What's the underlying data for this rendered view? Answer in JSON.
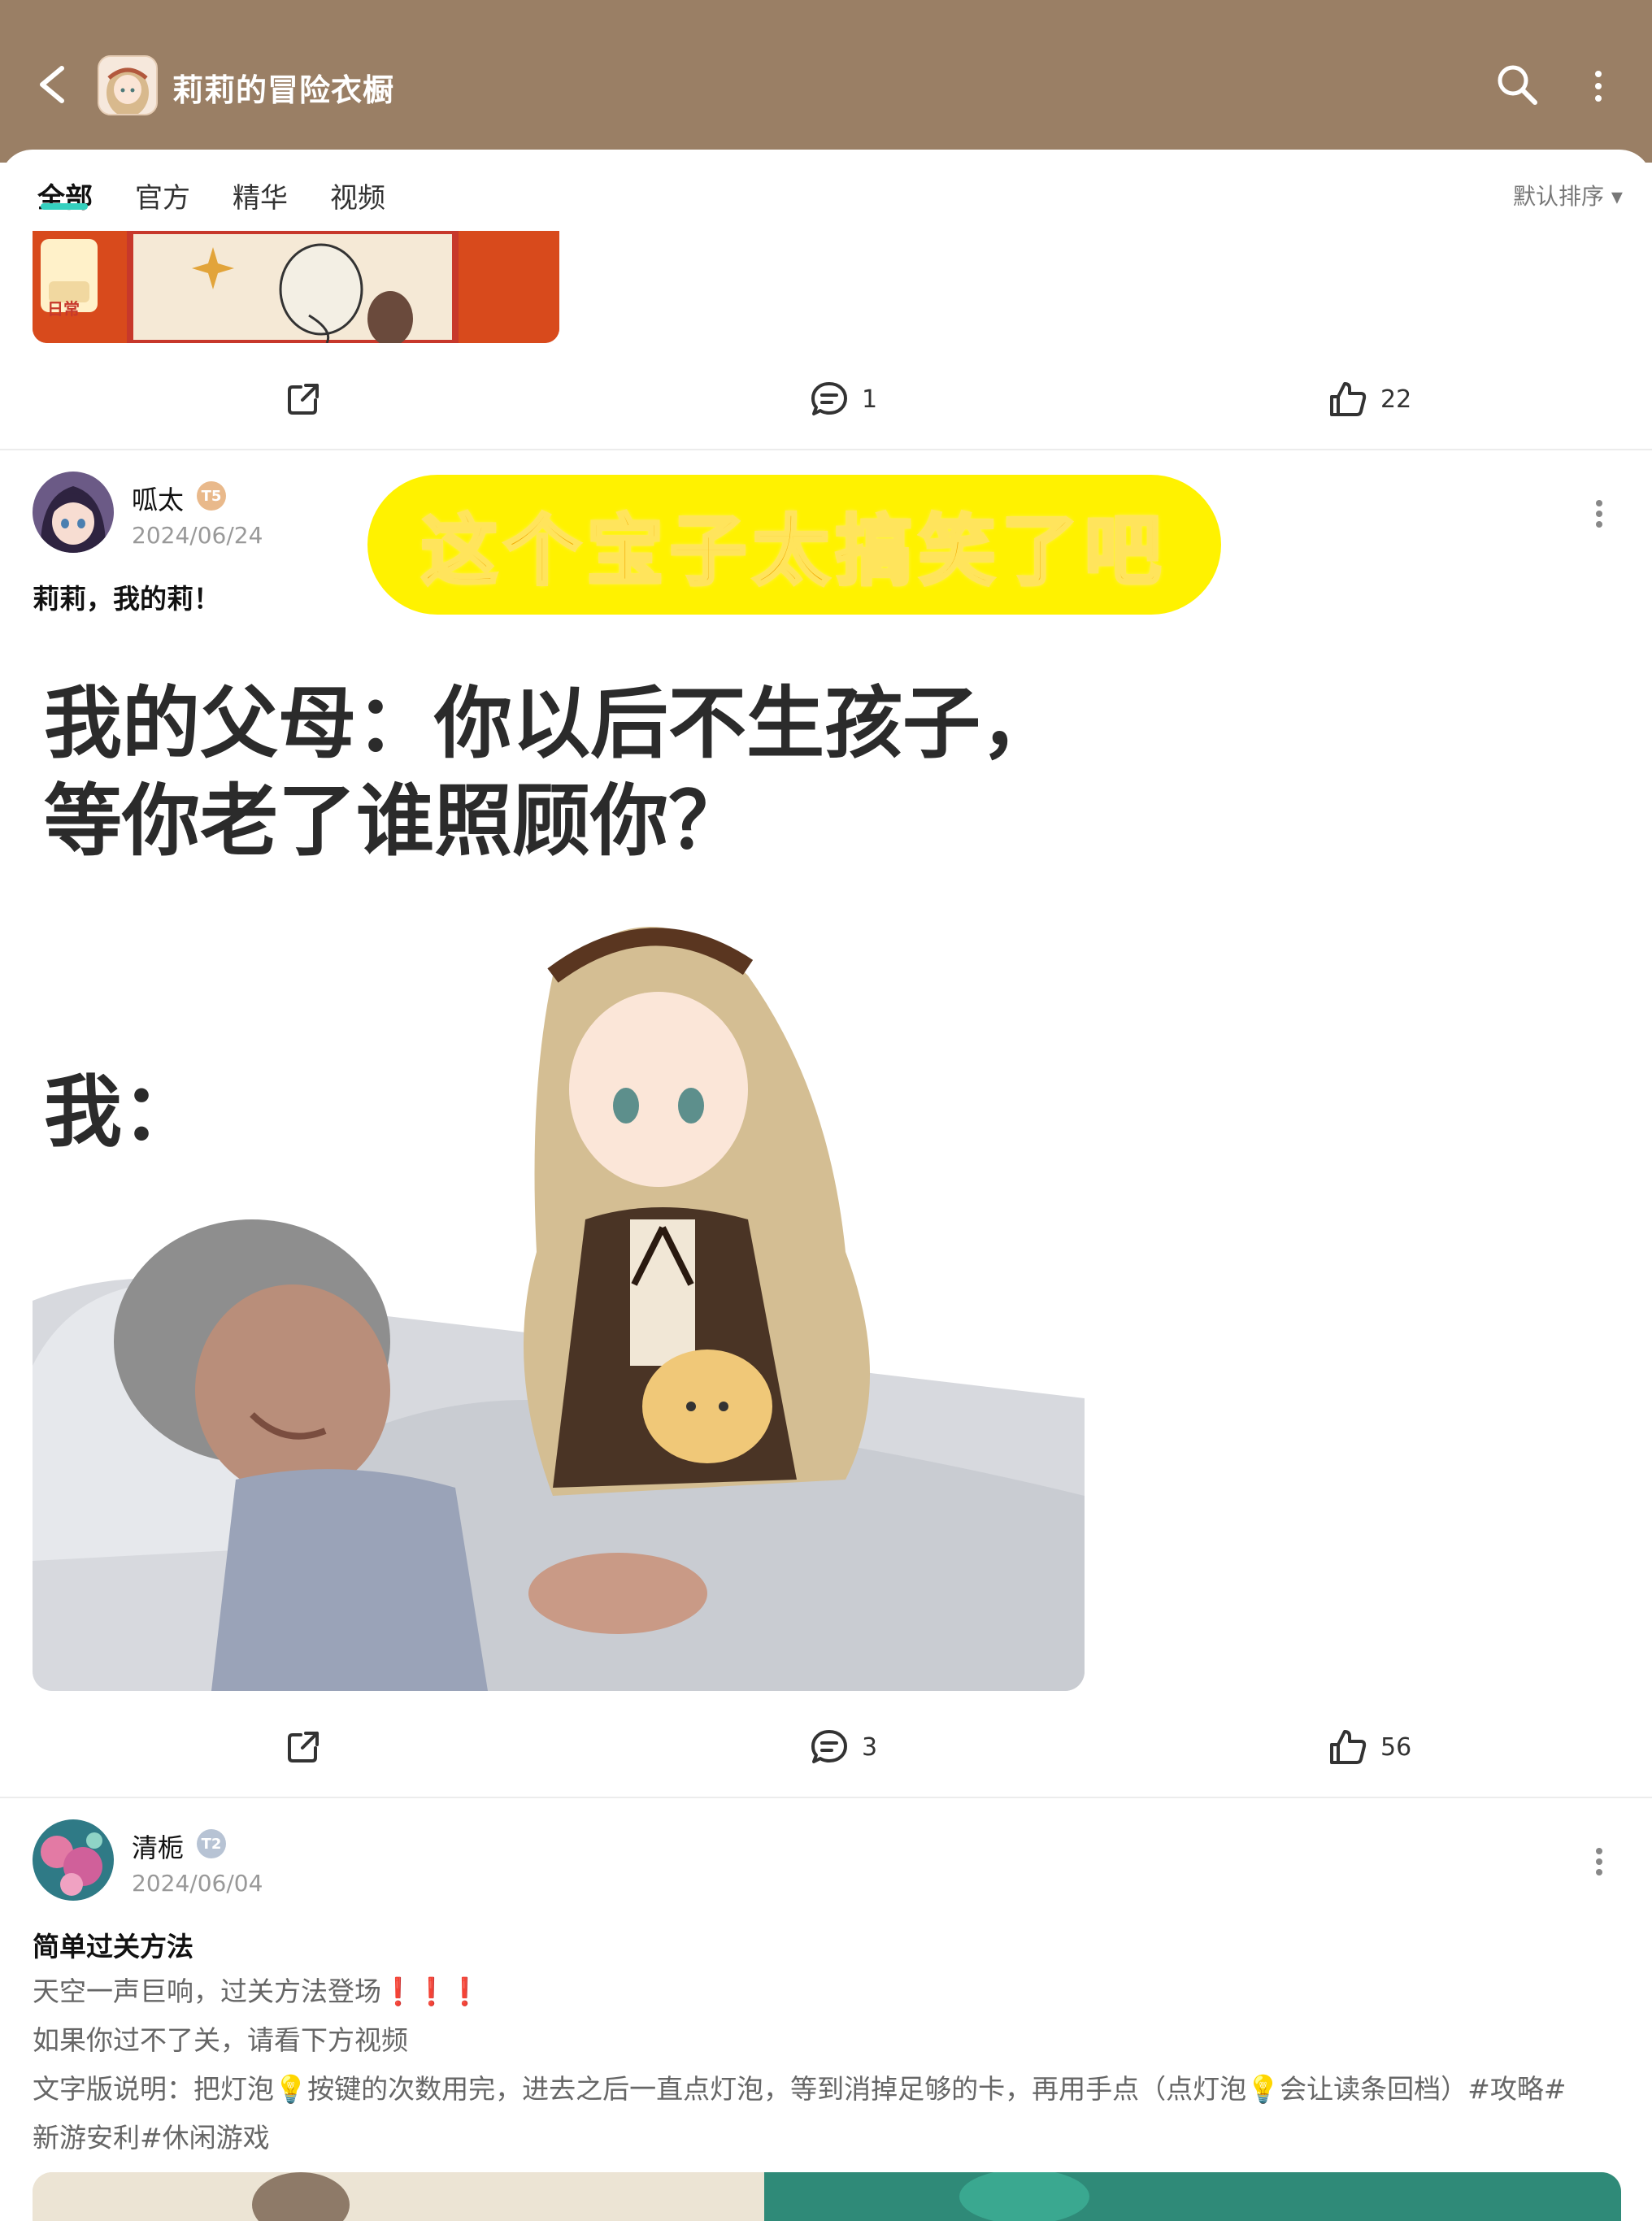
{
  "header": {
    "title": "莉莉的冒险衣橱"
  },
  "tabs": [
    {
      "label": "全部",
      "active": true
    },
    {
      "label": "官方",
      "active": false
    },
    {
      "label": "精华",
      "active": false
    },
    {
      "label": "视频",
      "active": false
    }
  ],
  "sort_label": "默认排序 ▾",
  "prev_post": {
    "comments": "1",
    "likes": "22",
    "image_badge": "日常"
  },
  "post1": {
    "username": "呱太",
    "level": "T5",
    "date": "2024/06/24",
    "title": "莉莉，我的莉！",
    "banner": "这个宝子太搞笑了吧",
    "meme_line1": "我的父母：你以后不生孩子，",
    "meme_line2": "等你老了谁照顾你？",
    "meme_line3": "我：",
    "comments": "3",
    "likes": "56"
  },
  "post2": {
    "username": "清栀",
    "level": "T2",
    "date": "2024/06/04",
    "title": "简单过关方法",
    "line1": "天空一声巨响，过关方法登场❗❗❗",
    "line2": "如果你过不了关，请看下方视频",
    "line3": "文字版说明：把灯泡💡按键的次数用完，进去之后一直点灯泡，等到消掉足够的卡，再用手点（点灯泡💡会让读条回档）#攻略#",
    "line4": "新游安利#休闲游戏"
  }
}
